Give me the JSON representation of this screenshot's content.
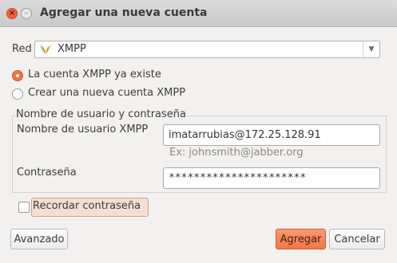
{
  "window": {
    "title": "Agregar una nueva cuenta",
    "close_glyph": "×",
    "minimize_glyph": "–"
  },
  "network": {
    "label": "Red",
    "selected": "XMPP",
    "icon": "xmpp-logo-icon",
    "arrow_glyph": "▼"
  },
  "options": {
    "existing": "La cuenta XMPP ya existe",
    "create": "Crear una nueva cuenta XMPP",
    "selected": "existing"
  },
  "credentials": {
    "legend": "Nombre de usuario y contraseña",
    "username_label": "Nombre de usuario XMPP",
    "username_value": "imatarrubias@172.25.128.91",
    "username_hint": "Ex: johnsmith@jabber.org",
    "password_label": "Contraseña",
    "password_value": "**********************"
  },
  "remember": {
    "label": "Recordar contraseña",
    "checked": false
  },
  "buttons": {
    "advanced": "Avanzado",
    "add": "Agregar",
    "cancel": "Cancelar"
  },
  "colors": {
    "accent": "#f07746",
    "accent_dark": "#c7562b",
    "background": "#f2f1f0"
  }
}
